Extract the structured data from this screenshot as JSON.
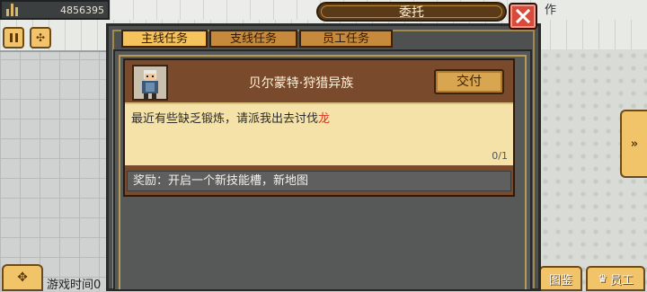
{
  "hud": {
    "money": "4856395",
    "top_right_label": "作",
    "game_time_label": "游戏时间0",
    "gallery_label": "图鉴",
    "staff_label": "员工"
  },
  "dialog": {
    "title": "委托",
    "tabs": [
      {
        "label": "主线任务",
        "active": true
      },
      {
        "label": "支线任务",
        "active": false
      },
      {
        "label": "员工任务",
        "active": false
      }
    ],
    "quest": {
      "title": "贝尔蒙特·狩猎异族",
      "submit_label": "交付",
      "description": "最近有些缺乏锻炼，请派我出去讨伐",
      "description_highlight": "龙",
      "progress": "0/1",
      "reward": "奖励：开启一个新技能槽，新地图"
    }
  },
  "colors": {
    "tab_active": "#f6c25c",
    "tab_inactive": "#c78a3c",
    "close_red": "#d94a3a",
    "highlight_red": "#e23020"
  }
}
